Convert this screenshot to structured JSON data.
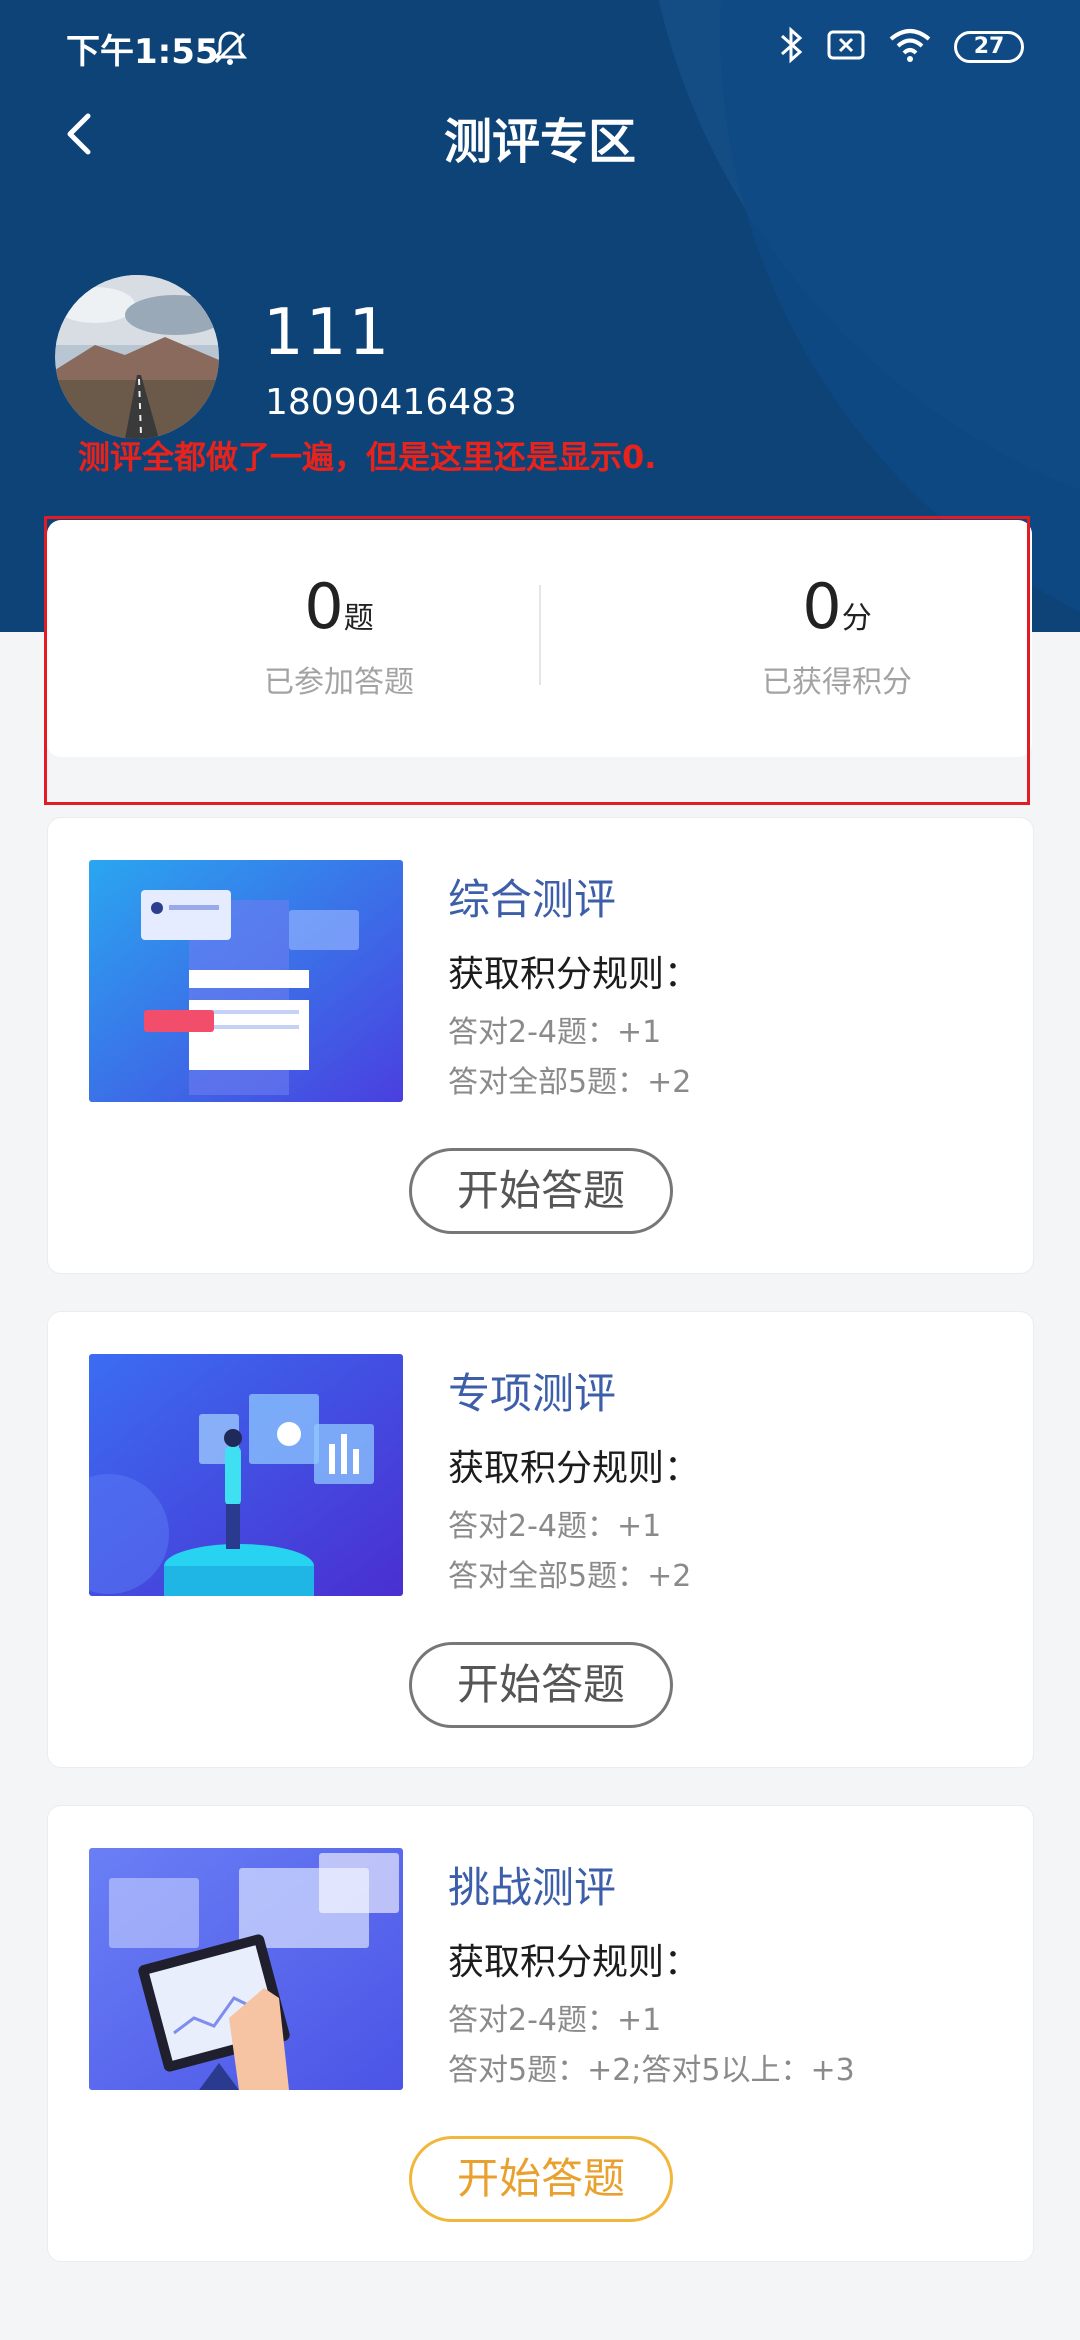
{
  "status_bar": {
    "time": "下午1:55",
    "battery": "27"
  },
  "nav": {
    "title": "测评专区"
  },
  "user": {
    "name": "111",
    "phone": "18090416483"
  },
  "annotation": "测评全都做了一遍，但是这里还是显示0.",
  "stats": [
    {
      "value": "0",
      "unit": "题",
      "label": "已参加答题"
    },
    {
      "value": "0",
      "unit": "分",
      "label": "已获得积分"
    }
  ],
  "evaluations": [
    {
      "title": "综合测评",
      "rule_title": "获取积分规则：",
      "rules": [
        "答对2-4题：+1",
        "答对全部5题：+2"
      ],
      "button": "开始答题"
    },
    {
      "title": "专项测评",
      "rule_title": "获取积分规则：",
      "rules": [
        "答对2-4题：+1",
        "答对全部5题：+2"
      ],
      "button": "开始答题"
    },
    {
      "title": "挑战测评",
      "rule_title": "获取积分规则：",
      "rules": [
        "答对2-4题：+1",
        "答对5题：+2;答对5以上：+3"
      ],
      "button": "开始答题"
    }
  ],
  "colors": {
    "header": "#0d4377",
    "title_blue": "#3d5ea8",
    "annotation_red": "#e8231b",
    "button_orange": "#e8a12e"
  }
}
